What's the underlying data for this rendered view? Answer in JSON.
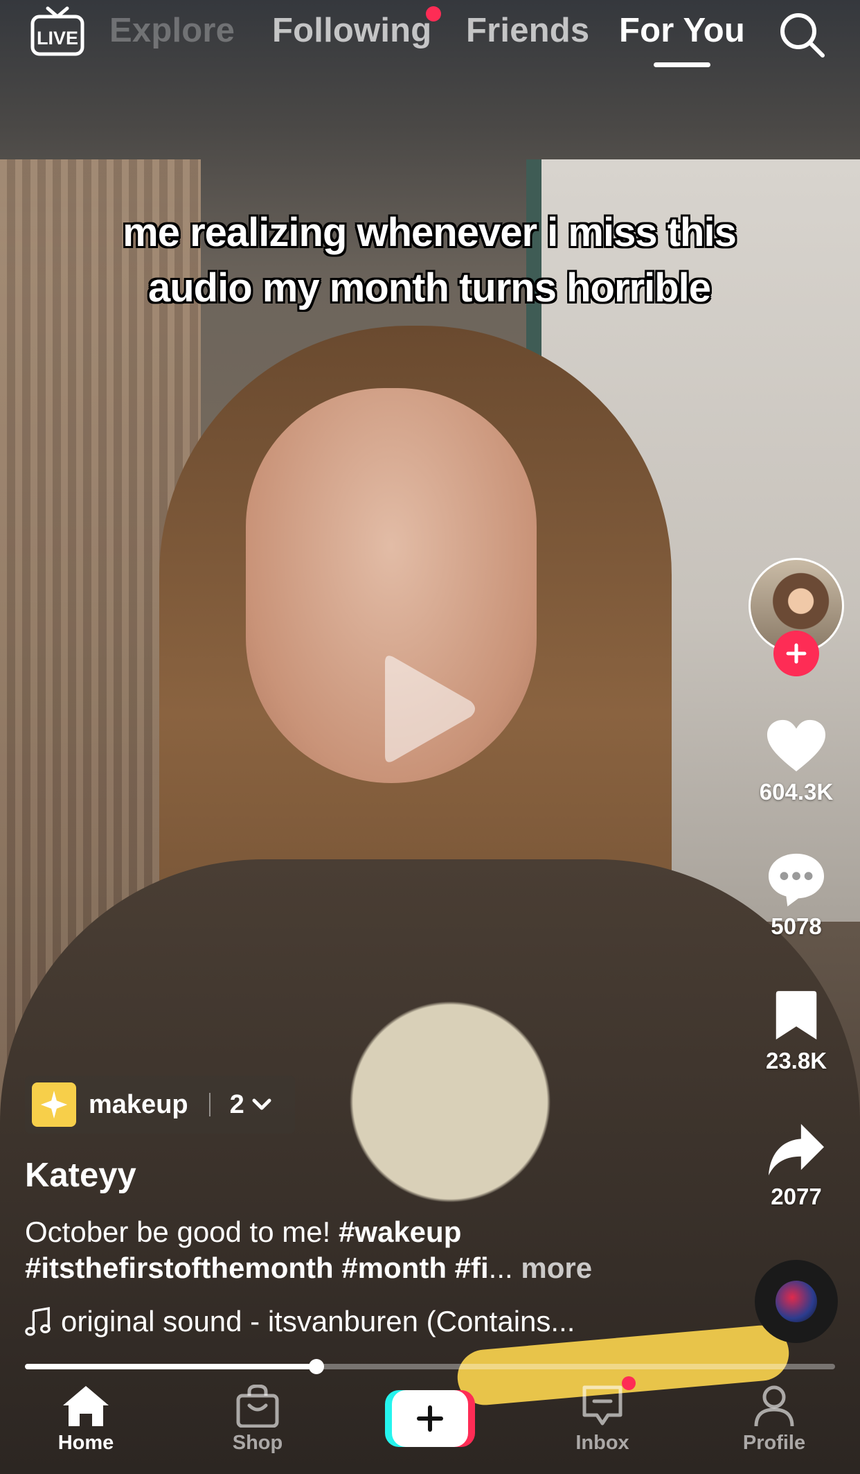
{
  "top_nav": {
    "live_label": "LIVE",
    "tabs": [
      {
        "label": "Explore",
        "active": false
      },
      {
        "label": "Following",
        "active": false,
        "has_dot": true
      },
      {
        "label": "Friends",
        "active": false
      },
      {
        "label": "For You",
        "active": true
      }
    ]
  },
  "video": {
    "overlay_text": "me realizing whenever i miss this audio my month turns horrible"
  },
  "right_rail": {
    "like_count": "604.3K",
    "comment_count": "5078",
    "save_count": "23.8K",
    "share_count": "2077"
  },
  "playlist": {
    "name": "makeup",
    "count": "2"
  },
  "post": {
    "username": "Kateyy",
    "description_text": "October be good to me! ",
    "hashtags_line1": "#wakeup",
    "hashtags_line2": "#itsthefirstofthemonth #month #fi",
    "ellipsis": "...",
    "more_label": "more",
    "sound": "original sound - itsvanburen (Contains..."
  },
  "progress": 0.36,
  "bottom_nav": {
    "items": [
      {
        "label": "Home",
        "active": true
      },
      {
        "label": "Shop",
        "active": false
      },
      {
        "label": "Inbox",
        "active": false,
        "has_dot": true
      },
      {
        "label": "Profile",
        "active": false
      }
    ]
  },
  "colors": {
    "accent_red": "#fe2c55",
    "accent_cyan": "#25f4ee",
    "playlist_icon": "#f7cf4a"
  },
  "icons": {
    "live": "live-tv-icon",
    "search": "search-icon",
    "play": "play-icon",
    "like": "heart-icon",
    "comment": "comment-bubble-icon",
    "save": "bookmark-icon",
    "share": "share-arrow-icon",
    "sound": "music-note-icon",
    "home": "home-icon",
    "shop": "shopping-bag-icon",
    "create": "plus-icon",
    "inbox": "inbox-icon",
    "profile": "person-icon"
  }
}
